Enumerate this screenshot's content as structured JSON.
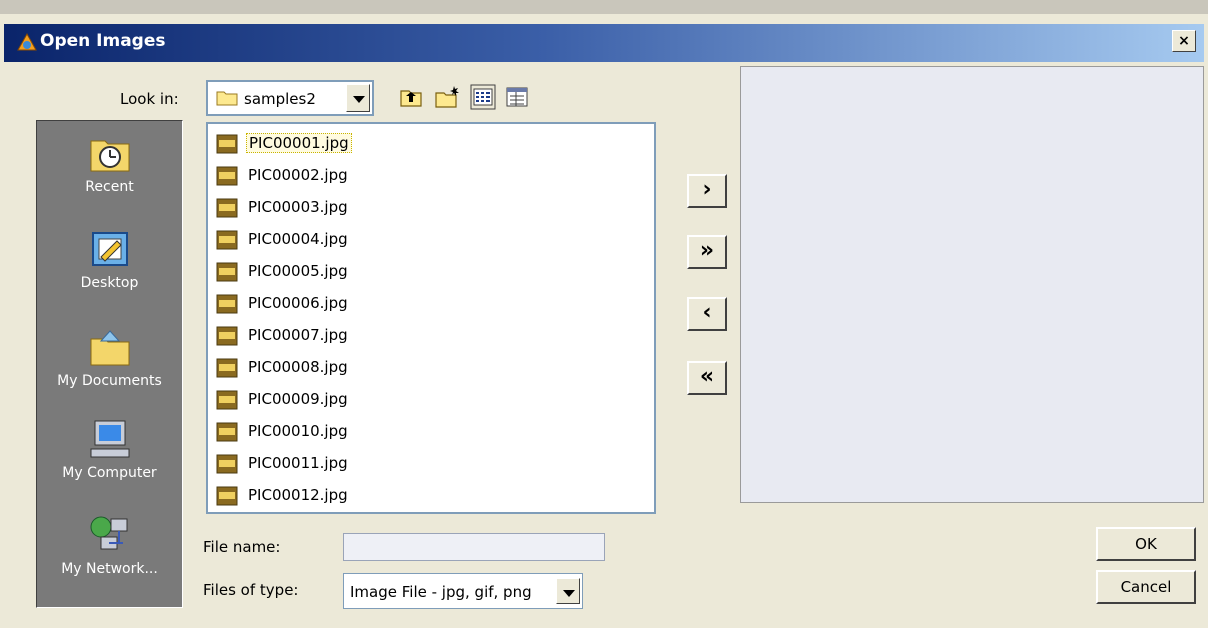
{
  "window": {
    "title": "Open Images",
    "close_label": "×"
  },
  "look_in": {
    "label": "Look in:",
    "value": "samples2"
  },
  "toolbar_icons": [
    "up-folder-icon",
    "new-folder-icon",
    "list-view-icon",
    "details-view-icon"
  ],
  "places": [
    {
      "label": "Recent",
      "icon": "recent-icon"
    },
    {
      "label": "Desktop",
      "icon": "desktop-icon"
    },
    {
      "label": "My Documents",
      "icon": "my-documents-icon"
    },
    {
      "label": "My Computer",
      "icon": "my-computer-icon"
    },
    {
      "label": "My Network...",
      "icon": "my-network-icon"
    }
  ],
  "files": [
    "PIC00001.jpg",
    "PIC00002.jpg",
    "PIC00003.jpg",
    "PIC00004.jpg",
    "PIC00005.jpg",
    "PIC00006.jpg",
    "PIC00007.jpg",
    "PIC00008.jpg",
    "PIC00009.jpg",
    "PIC00010.jpg",
    "PIC00011.jpg",
    "PIC00012.jpg"
  ],
  "selected_file": "PIC00001.jpg",
  "transfer_buttons": {
    "add": "›",
    "add_all": "»",
    "remove": "‹",
    "remove_all": "«"
  },
  "file_name": {
    "label": "File name:",
    "value": ""
  },
  "file_type": {
    "label": "Files of type:",
    "value": "Image File - jpg, gif, png"
  },
  "buttons": {
    "ok": "OK",
    "cancel": "Cancel"
  }
}
